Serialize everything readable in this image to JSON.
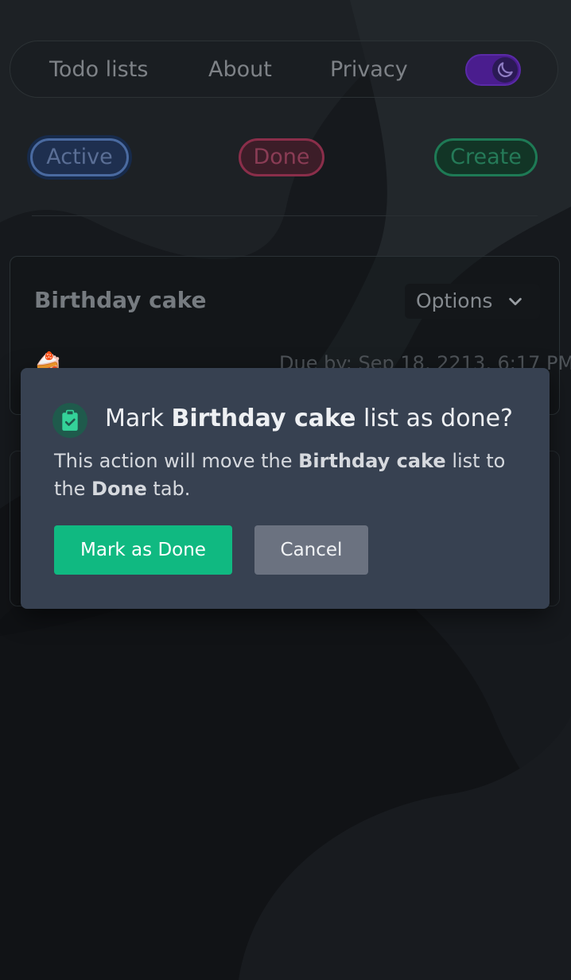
{
  "nav": {
    "todo_lists": "Todo lists",
    "about": "About",
    "privacy": "Privacy",
    "theme_toggle_icon": "moon-icon"
  },
  "tabs": {
    "active": "Active",
    "done": "Done",
    "create": "Create"
  },
  "list_card": {
    "title": "Birthday cake",
    "options_label": "Options",
    "emoji": "🍰",
    "due": "Due by: Sep 18, 2213, 6:17 PM"
  },
  "modal": {
    "icon": "clipboard-check-icon",
    "title_prefix": "Mark ",
    "title_name": "Birthday cake",
    "title_suffix": " list as done?",
    "body_prefix": "This action will move the ",
    "body_name": "Birthday cake",
    "body_middle": " list to the ",
    "body_tab": "Done",
    "body_suffix": " tab.",
    "confirm_label": "Mark as Done",
    "cancel_label": "Cancel"
  },
  "colors": {
    "confirm": "#10b981",
    "cancel": "#6b7280",
    "modal_bg": "#374151",
    "toggle": "#4a1d8e"
  }
}
